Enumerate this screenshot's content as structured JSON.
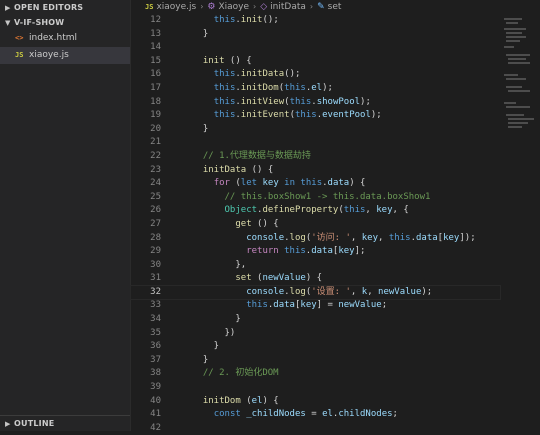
{
  "sidebar": {
    "open_editors": "OPEN EDITORS",
    "folder": "V-IF-SHOW",
    "files": [
      {
        "icon": "<>",
        "name": "index.html"
      },
      {
        "icon": "JS",
        "name": "xiaoye.js"
      }
    ],
    "outline": "OUTLINE"
  },
  "breadcrumb": {
    "file_icon": "JS",
    "file": "xiaoye.js",
    "class": "Xiaoye",
    "method": "initData",
    "prop": "set"
  },
  "code": {
    "line_numbers": [
      "12",
      "13",
      "14",
      "15",
      "16",
      "17",
      "18",
      "19",
      "20",
      "21",
      "22",
      "23",
      "24",
      "25",
      "26",
      "27",
      "28",
      "29",
      "30",
      "31",
      "32",
      "33",
      "34",
      "35",
      "36",
      "37",
      "38",
      "39",
      "40",
      "41",
      "42"
    ]
  }
}
